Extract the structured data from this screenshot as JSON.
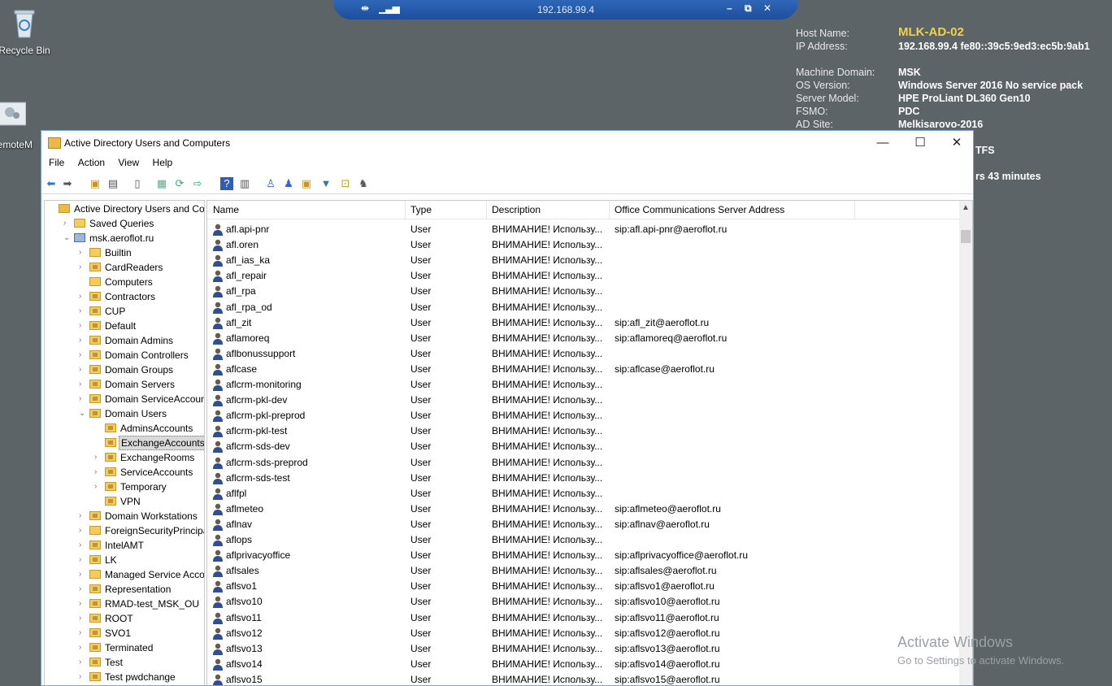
{
  "desktop": {
    "icons": [
      {
        "label": "Recycle Bin"
      },
      {
        "label": "RemoteM"
      }
    ]
  },
  "rdp_bar": {
    "host": "192.168.99.4"
  },
  "bginfo": {
    "host_name_label": "Host Name:",
    "host_name": "MLK-AD-02",
    "ip_label": "IP Address:",
    "ip": "192.168.99.4 fe80::39c5:9ed3:ec5b:9ab1",
    "domain_label": "Machine Domain:",
    "domain": "MSK",
    "os_label": "OS Version:",
    "os": "Windows Server 2016 No service pack",
    "model_label": "Server Model:",
    "model": "HPE ProLiant DL360 Gen10",
    "fsmo_label": "FSMO:",
    "fsmo": "PDC",
    "site_label": "AD Site:",
    "site": "Melkisarovo-2016",
    "extra1": "TFS",
    "extra2": "rs 43 minutes"
  },
  "window": {
    "title": "Active Directory Users and Computers",
    "menu": [
      "File",
      "Action",
      "View",
      "Help"
    ]
  },
  "tree": [
    {
      "label": "Active Directory Users and Com",
      "level": 0,
      "exp": "",
      "kind": "root"
    },
    {
      "label": "Saved Queries",
      "level": 1,
      "exp": "›",
      "kind": "folder"
    },
    {
      "label": "msk.aeroflot.ru",
      "level": 1,
      "exp": "⌄",
      "kind": "domain"
    },
    {
      "label": "Builtin",
      "level": 2,
      "exp": "›",
      "kind": "folder"
    },
    {
      "label": "CardReaders",
      "level": 2,
      "exp": "›",
      "kind": "ou"
    },
    {
      "label": "Computers",
      "level": 2,
      "exp": "",
      "kind": "folder"
    },
    {
      "label": "Contractors",
      "level": 2,
      "exp": "›",
      "kind": "ou"
    },
    {
      "label": "CUP",
      "level": 2,
      "exp": "›",
      "kind": "ou"
    },
    {
      "label": "Default",
      "level": 2,
      "exp": "›",
      "kind": "ou"
    },
    {
      "label": "Domain Admins",
      "level": 2,
      "exp": "›",
      "kind": "ou"
    },
    {
      "label": "Domain Controllers",
      "level": 2,
      "exp": "›",
      "kind": "ou"
    },
    {
      "label": "Domain Groups",
      "level": 2,
      "exp": "›",
      "kind": "ou"
    },
    {
      "label": "Domain Servers",
      "level": 2,
      "exp": "›",
      "kind": "ou"
    },
    {
      "label": "Domain ServiceAccounts",
      "level": 2,
      "exp": "›",
      "kind": "ou"
    },
    {
      "label": "Domain Users",
      "level": 2,
      "exp": "⌄",
      "kind": "ou"
    },
    {
      "label": "AdminsAccounts",
      "level": 3,
      "exp": "",
      "kind": "ou"
    },
    {
      "label": "ExchangeAccounts",
      "level": 3,
      "exp": "",
      "kind": "ou",
      "selected": true
    },
    {
      "label": "ExchangeRooms",
      "level": 3,
      "exp": "›",
      "kind": "ou"
    },
    {
      "label": "ServiceAccounts",
      "level": 3,
      "exp": "›",
      "kind": "ou"
    },
    {
      "label": "Temporary",
      "level": 3,
      "exp": "›",
      "kind": "ou"
    },
    {
      "label": "VPN",
      "level": 3,
      "exp": "",
      "kind": "ou"
    },
    {
      "label": "Domain Workstations",
      "level": 2,
      "exp": "›",
      "kind": "ou"
    },
    {
      "label": "ForeignSecurityPrincipals",
      "level": 2,
      "exp": "›",
      "kind": "folder"
    },
    {
      "label": "IntelAMT",
      "level": 2,
      "exp": "›",
      "kind": "ou"
    },
    {
      "label": "LK",
      "level": 2,
      "exp": "›",
      "kind": "ou"
    },
    {
      "label": "Managed Service Accour",
      "level": 2,
      "exp": "›",
      "kind": "folder"
    },
    {
      "label": "Representation",
      "level": 2,
      "exp": "›",
      "kind": "ou"
    },
    {
      "label": "RMAD-test_MSK_OU",
      "level": 2,
      "exp": "›",
      "kind": "ou"
    },
    {
      "label": "ROOT",
      "level": 2,
      "exp": "›",
      "kind": "ou"
    },
    {
      "label": "SVO1",
      "level": 2,
      "exp": "›",
      "kind": "ou"
    },
    {
      "label": "Terminated",
      "level": 2,
      "exp": "›",
      "kind": "ou"
    },
    {
      "label": "Test",
      "level": 2,
      "exp": "›",
      "kind": "ou"
    },
    {
      "label": "Test pwdchange",
      "level": 2,
      "exp": "›",
      "kind": "ou"
    }
  ],
  "list": {
    "columns": [
      "Name",
      "Type",
      "Description",
      "Office Communications Server Address"
    ],
    "rows": [
      [
        "afl.api-pnr",
        "User",
        "ВНИМАНИЕ! Использу...",
        "sip:afl.api-pnr@aeroflot.ru"
      ],
      [
        "afl.oren",
        "User",
        "ВНИМАНИЕ! Использу...",
        ""
      ],
      [
        "afl_ias_ka",
        "User",
        "ВНИМАНИЕ! Использу...",
        ""
      ],
      [
        "afl_repair",
        "User",
        "ВНИМАНИЕ! Использу...",
        ""
      ],
      [
        "afl_rpa",
        "User",
        "ВНИМАНИЕ! Использу...",
        ""
      ],
      [
        "afl_rpa_od",
        "User",
        "ВНИМАНИЕ! Использу...",
        ""
      ],
      [
        "afl_zit",
        "User",
        "ВНИМАНИЕ! Использу...",
        "sip:afl_zit@aeroflot.ru"
      ],
      [
        "aflamoreq",
        "User",
        "ВНИМАНИЕ! Использу...",
        "sip:aflamoreq@aeroflot.ru"
      ],
      [
        "aflbonussupport",
        "User",
        "ВНИМАНИЕ! Использу...",
        ""
      ],
      [
        "aflcase",
        "User",
        "ВНИМАНИЕ! Использу...",
        "sip:aflcase@aeroflot.ru"
      ],
      [
        "aflcrm-monitoring",
        "User",
        "ВНИМАНИЕ! Использу...",
        ""
      ],
      [
        "aflcrm-pkl-dev",
        "User",
        "ВНИМАНИЕ! Использу...",
        ""
      ],
      [
        "aflcrm-pkl-preprod",
        "User",
        "ВНИМАНИЕ! Использу...",
        ""
      ],
      [
        "aflcrm-pkl-test",
        "User",
        "ВНИМАНИЕ! Использу...",
        ""
      ],
      [
        "aflcrm-sds-dev",
        "User",
        "ВНИМАНИЕ! Использу...",
        ""
      ],
      [
        "aflcrm-sds-preprod",
        "User",
        "ВНИМАНИЕ! Использу...",
        ""
      ],
      [
        "aflcrm-sds-test",
        "User",
        "ВНИМАНИЕ! Использу...",
        ""
      ],
      [
        "aflfpl",
        "User",
        "ВНИМАНИЕ! Использу...",
        ""
      ],
      [
        "aflmeteo",
        "User",
        "ВНИМАНИЕ! Использу...",
        "sip:aflmeteo@aeroflot.ru"
      ],
      [
        "aflnav",
        "User",
        "ВНИМАНИЕ! Использу...",
        "sip:aflnav@aeroflot.ru"
      ],
      [
        "aflops",
        "User",
        "ВНИМАНИЕ! Использу...",
        ""
      ],
      [
        "aflprivacyoffice",
        "User",
        "ВНИМАНИЕ! Использу...",
        "sip:aflprivacyoffice@aeroflot.ru"
      ],
      [
        "aflsales",
        "User",
        "ВНИМАНИЕ! Использу...",
        "sip:aflsales@aeroflot.ru"
      ],
      [
        "aflsvo1",
        "User",
        "ВНИМАНИЕ! Использу...",
        "sip:aflsvo1@aeroflot.ru"
      ],
      [
        "aflsvo10",
        "User",
        "ВНИМАНИЕ! Использу...",
        "sip:aflsvo10@aeroflot.ru"
      ],
      [
        "aflsvo11",
        "User",
        "ВНИМАНИЕ! Использу...",
        "sip:aflsvo11@aeroflot.ru"
      ],
      [
        "aflsvo12",
        "User",
        "ВНИМАНИЕ! Использу...",
        "sip:aflsvo12@aeroflot.ru"
      ],
      [
        "aflsvo13",
        "User",
        "ВНИМАНИЕ! Использу...",
        "sip:aflsvo13@aeroflot.ru"
      ],
      [
        "aflsvo14",
        "User",
        "ВНИМАНИЕ! Использу...",
        "sip:aflsvo14@aeroflot.ru"
      ],
      [
        "aflsvo15",
        "User",
        "ВНИМАНИЕ! Использу...",
        "sip:aflsvo15@aeroflot.ru"
      ]
    ]
  },
  "watermark": {
    "line1": "Activate Windows",
    "line2": "Go to Settings to activate Windows."
  }
}
